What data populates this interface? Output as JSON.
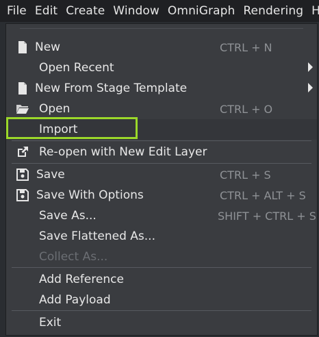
{
  "menubar": {
    "items": [
      "File",
      "Edit",
      "Create",
      "Window",
      "OmniGraph",
      "Rendering",
      "Help"
    ]
  },
  "file_menu": {
    "items": [
      {
        "label": "New",
        "shortcut": "CTRL + N",
        "icon": "document-icon"
      },
      {
        "label": "Open Recent",
        "submenu": true
      },
      {
        "label": "New From Stage Template",
        "submenu": true,
        "icon": "document-icon"
      },
      {
        "label": "Open",
        "shortcut": "CTRL + O",
        "icon": "folder-open-icon"
      },
      {
        "label": "Import"
      },
      {
        "label": "Re-open with New Edit Layer",
        "icon": "external-link-icon"
      },
      {
        "label": "Save",
        "shortcut": "CTRL + S",
        "icon": "save-icon"
      },
      {
        "label": "Save With Options",
        "shortcut": "CTRL + ALT + S",
        "icon": "save-icon"
      },
      {
        "label": "Save As...",
        "shortcut": "SHIFT + CTRL + S"
      },
      {
        "label": "Save Flattened As..."
      },
      {
        "label": "Collect As...",
        "disabled": true
      },
      {
        "label": "Add Reference"
      },
      {
        "label": "Add Payload"
      },
      {
        "label": "Exit"
      }
    ]
  },
  "colors": {
    "menubar_bg": "#1f2023",
    "menu_bg": "#3a3c40",
    "text": "#e8e8e8",
    "shortcut": "#8f9296",
    "disabled": "#6b6e73",
    "highlight_outline": "#9bd82a"
  }
}
